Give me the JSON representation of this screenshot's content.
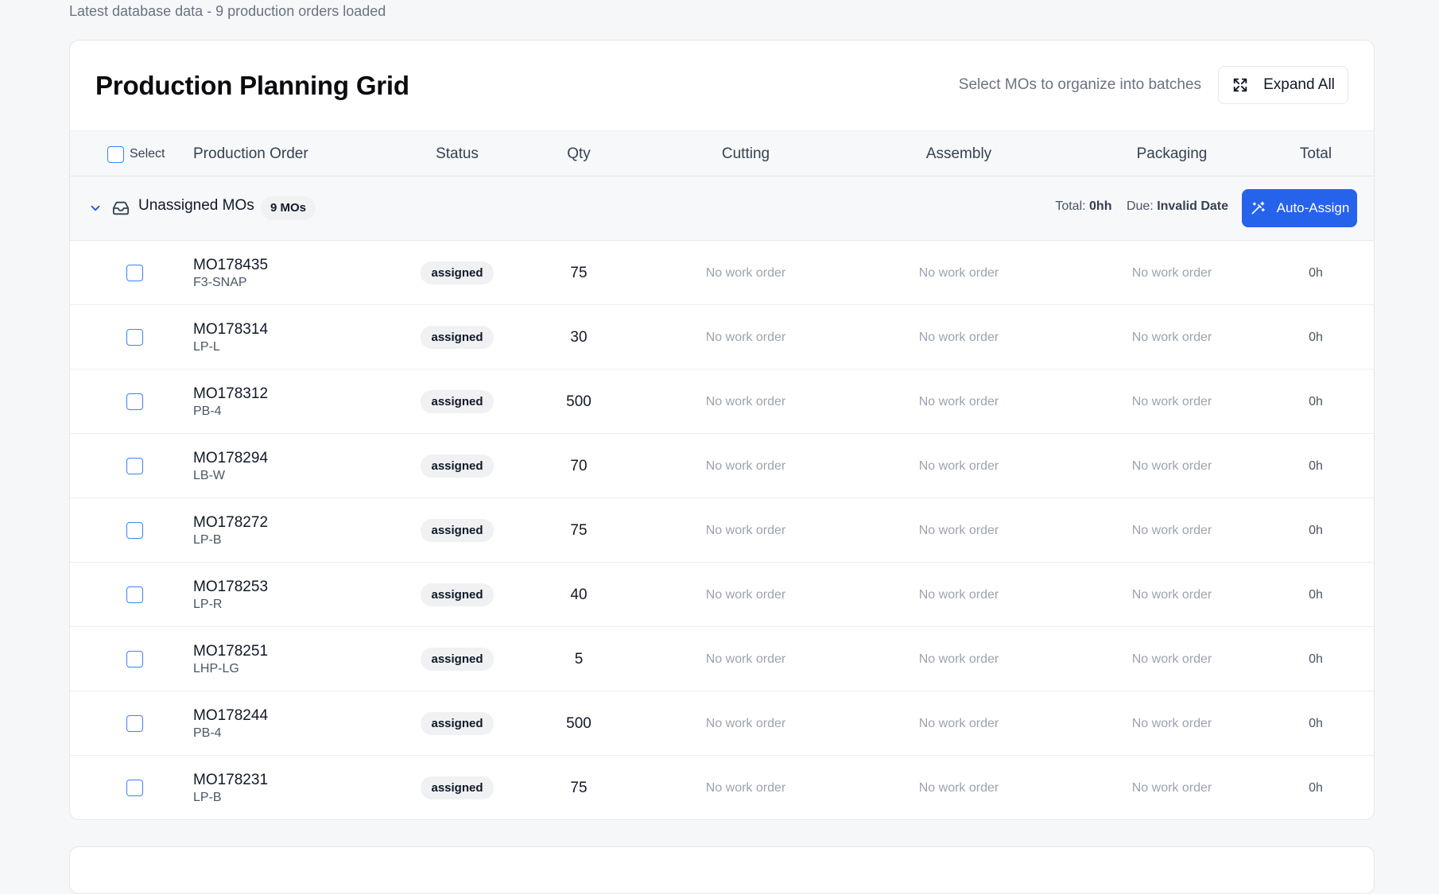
{
  "subtitle": "Latest database data - 9 production orders loaded",
  "card": {
    "title": "Production Planning Grid",
    "hint": "Select MOs to organize into batches",
    "expand_label": "Expand All"
  },
  "columns": {
    "select": "Select",
    "production_order": "Production Order",
    "status": "Status",
    "qty": "Qty",
    "cutting": "Cutting",
    "assembly": "Assembly",
    "packaging": "Packaging",
    "total": "Total"
  },
  "group": {
    "name": "Unassigned MOs",
    "badge": "9 MOs",
    "total_label": "Total:",
    "total_value": "0hh",
    "due_label": "Due:",
    "due_value": "Invalid Date",
    "auto_assign_label": "Auto-Assign"
  },
  "rows": [
    {
      "id": "MO178435",
      "sku": "F3-SNAP",
      "status": "assigned",
      "qty": "75",
      "cutting": "No work order",
      "assembly": "No work order",
      "packaging": "No work order",
      "total": "0h"
    },
    {
      "id": "MO178314",
      "sku": "LP-L",
      "status": "assigned",
      "qty": "30",
      "cutting": "No work order",
      "assembly": "No work order",
      "packaging": "No work order",
      "total": "0h"
    },
    {
      "id": "MO178312",
      "sku": "PB-4",
      "status": "assigned",
      "qty": "500",
      "cutting": "No work order",
      "assembly": "No work order",
      "packaging": "No work order",
      "total": "0h"
    },
    {
      "id": "MO178294",
      "sku": "LB-W",
      "status": "assigned",
      "qty": "70",
      "cutting": "No work order",
      "assembly": "No work order",
      "packaging": "No work order",
      "total": "0h"
    },
    {
      "id": "MO178272",
      "sku": "LP-B",
      "status": "assigned",
      "qty": "75",
      "cutting": "No work order",
      "assembly": "No work order",
      "packaging": "No work order",
      "total": "0h"
    },
    {
      "id": "MO178253",
      "sku": "LP-R",
      "status": "assigned",
      "qty": "40",
      "cutting": "No work order",
      "assembly": "No work order",
      "packaging": "No work order",
      "total": "0h"
    },
    {
      "id": "MO178251",
      "sku": "LHP-LG",
      "status": "assigned",
      "qty": "5",
      "cutting": "No work order",
      "assembly": "No work order",
      "packaging": "No work order",
      "total": "0h"
    },
    {
      "id": "MO178244",
      "sku": "PB-4",
      "status": "assigned",
      "qty": "500",
      "cutting": "No work order",
      "assembly": "No work order",
      "packaging": "No work order",
      "total": "0h"
    },
    {
      "id": "MO178231",
      "sku": "LP-B",
      "status": "assigned",
      "qty": "75",
      "cutting": "No work order",
      "assembly": "No work order",
      "packaging": "No work order",
      "total": "0h"
    }
  ],
  "colors": {
    "accent": "#2563eb",
    "checkbox_border": "#3b82f6",
    "badge_bg": "#f0f1f3",
    "muted_text": "#9ca3af"
  },
  "icons": {
    "expand": "expand-arrows-icon",
    "chevron": "chevron-down-icon",
    "group": "inbox-icon",
    "auto_assign": "magic-wand-icon"
  }
}
